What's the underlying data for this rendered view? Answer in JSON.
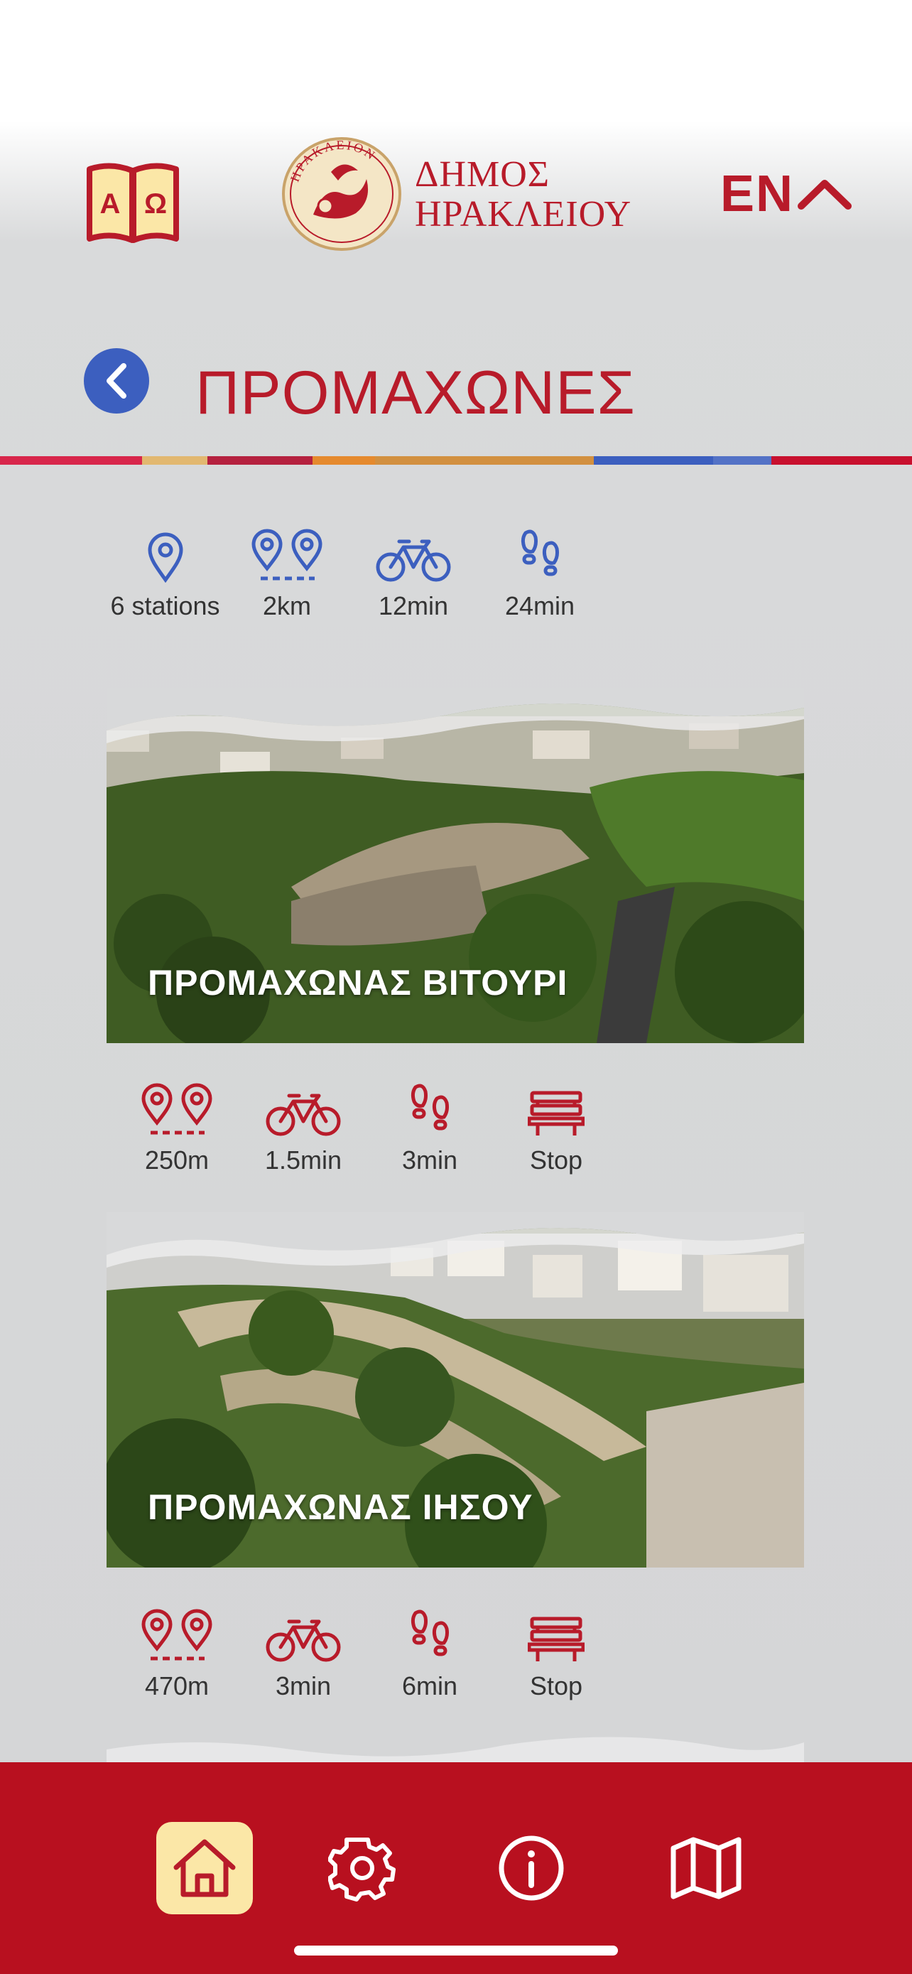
{
  "header": {
    "dictionary_letters": [
      "Α",
      "Ω"
    ],
    "logo_ring_text": "ΗΡΑΚΛΕΙΟΝ",
    "logo_line1": "ΔΗΜΟΣ",
    "logo_line2": "ΗΡΑΚΛΕΙΟΥ",
    "language": "EN"
  },
  "page": {
    "title": "ΠΡΟΜΑΧΩΝΕΣ"
  },
  "route_stats": [
    {
      "icon": "location-pin-icon",
      "label": "6 stations"
    },
    {
      "icon": "distance-pins-icon",
      "label": "2km"
    },
    {
      "icon": "bicycle-icon",
      "label": "12min"
    },
    {
      "icon": "footsteps-icon",
      "label": "24min"
    }
  ],
  "stations": [
    {
      "title": "ΠΡΟΜΑΧΩΝΑΣ ΒΙΤΟΥΡΙ",
      "stats": [
        {
          "icon": "distance-pins-icon",
          "label": "250m"
        },
        {
          "icon": "bicycle-icon",
          "label": "1.5min"
        },
        {
          "icon": "footsteps-icon",
          "label": "3min"
        },
        {
          "icon": "bench-icon",
          "label": "Stop"
        }
      ]
    },
    {
      "title": "ΠΡΟΜΑΧΩΝΑΣ ΙΗΣΟΥ",
      "stats": [
        {
          "icon": "distance-pins-icon",
          "label": "470m"
        },
        {
          "icon": "bicycle-icon",
          "label": "3min"
        },
        {
          "icon": "footsteps-icon",
          "label": "6min"
        },
        {
          "icon": "bench-icon",
          "label": "Stop"
        }
      ]
    }
  ],
  "bottom_nav": [
    {
      "icon": "home-icon",
      "active": true
    },
    {
      "icon": "gear-icon",
      "active": false
    },
    {
      "icon": "info-icon",
      "active": false
    },
    {
      "icon": "map-icon",
      "active": false
    }
  ],
  "colors": {
    "brand_red": "#b81b2a",
    "accent_blue": "#3c5fbf",
    "nav_active_bg": "#fbe7a7",
    "stripe": [
      "#d8264b",
      "#e2b870",
      "#b5213f",
      "#e58a2e",
      "#d29040",
      "#3c5fbf",
      "#5372c6",
      "#c8102e"
    ]
  }
}
